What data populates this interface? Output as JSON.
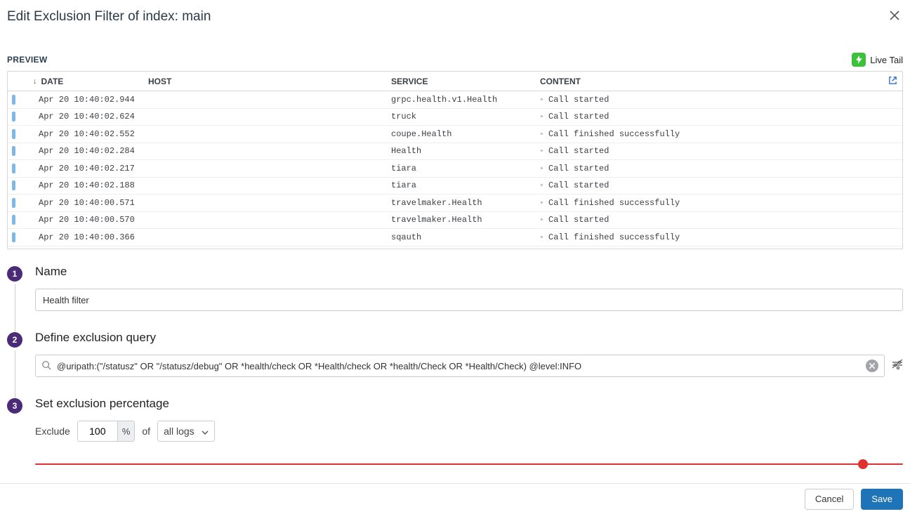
{
  "header": {
    "title": "Edit Exclusion Filter of index: main"
  },
  "preview": {
    "label": "PREVIEW",
    "live_tail": "Live Tail",
    "columns": {
      "date": "DATE",
      "host": "HOST",
      "service": "SERVICE",
      "content": "CONTENT"
    },
    "rows": [
      {
        "date": "Apr 20 10:40:02.944",
        "host": "",
        "service": "grpc.health.v1.Health",
        "content": "Call started"
      },
      {
        "date": "Apr 20 10:40:02.624",
        "host": "",
        "service": "truck",
        "content": "Call started"
      },
      {
        "date": "Apr 20 10:40:02.552",
        "host": "",
        "service": "coupe.Health",
        "content": "Call finished successfully"
      },
      {
        "date": "Apr 20 10:40:02.284",
        "host": "",
        "service": "Health",
        "content": "Call started"
      },
      {
        "date": "Apr 20 10:40:02.217",
        "host": "",
        "service": "tiara",
        "content": "Call started"
      },
      {
        "date": "Apr 20 10:40:02.188",
        "host": "",
        "service": "tiara",
        "content": "Call started"
      },
      {
        "date": "Apr 20 10:40:00.571",
        "host": "",
        "service": "travelmaker.Health",
        "content": "Call finished successfully"
      },
      {
        "date": "Apr 20 10:40:00.570",
        "host": "",
        "service": "travelmaker.Health",
        "content": "Call started"
      },
      {
        "date": "Apr 20 10:40:00.366",
        "host": "",
        "service": "sqauth",
        "content": "Call finished successfully"
      }
    ]
  },
  "steps": {
    "s1": {
      "num": "1",
      "title": "Name",
      "value": "Health filter"
    },
    "s2": {
      "num": "2",
      "title": "Define exclusion query",
      "value": "@uripath:(\"/statusz\" OR \"/statusz/debug\" OR *health/check OR *Health/check OR *health/Check OR *Health/Check) @level:INFO"
    },
    "s3": {
      "num": "3",
      "title": "Set exclusion percentage",
      "exclude_label": "Exclude",
      "pct_value": "100",
      "pct_suffix": "%",
      "of_label": "of",
      "scope": "all logs"
    }
  },
  "footer": {
    "cancel": "Cancel",
    "save": "Save"
  }
}
